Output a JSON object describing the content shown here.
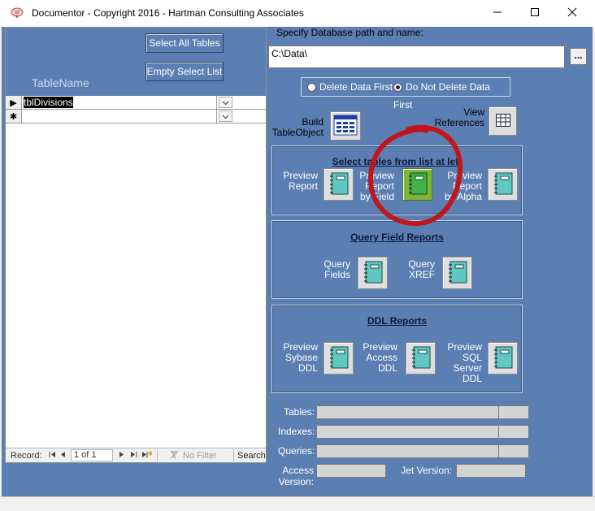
{
  "window": {
    "title": "Documentor - Copyright 2016 - Hartman Consulting Associates",
    "icons": {
      "app": "brain-icon",
      "minimize": "minimize-icon",
      "maximize": "maximize-icon",
      "close": "close-icon"
    }
  },
  "subform": {
    "select_all_label": "Select All Tables",
    "empty_list_label": "Empty Select List",
    "column_header": "TableName",
    "rows": [
      {
        "selector": "▶",
        "value": "tblDivisions"
      },
      {
        "selector": "✱",
        "value": ""
      }
    ],
    "nav": {
      "record_label": "Record:",
      "position": "1 of 1",
      "filter_label": "No Filter",
      "search_label": "Search"
    }
  },
  "db": {
    "path_label": "Specify Database path and name:",
    "path_value": "C:\\Data\\",
    "browse_label": "...",
    "radio_delete": "Delete Data First",
    "radio_no_delete": "Do Not Delete Data First",
    "selected_radio": "no_delete"
  },
  "top_actions": {
    "build_label": "Build\nTableObject",
    "view_label": "View\nReferences"
  },
  "panels": {
    "select_tables": {
      "title": "Select tables from list at left",
      "preview_report": "Preview\nReport",
      "preview_by_field": "Preview\nReport\nby Field",
      "preview_by_alpha": "Preview\nReport\nby Alpha"
    },
    "query_field": {
      "title": "Query Field Reports",
      "query_fields": "Query\nFields",
      "query_xref": "Query\nXREF"
    },
    "ddl": {
      "title": "DDL Reports",
      "sybase": "Preview\nSybase\nDDL",
      "access": "Preview\nAccess\nDDL",
      "sqlserver": "Preview\nSQL\nServer\nDDL"
    }
  },
  "progress": {
    "tables_label": "Tables:",
    "indexes_label": "Indexes:",
    "queries_label": "Queries:"
  },
  "versions": {
    "access_label": "Access Version:",
    "access_value": "",
    "jet_label": "Jet Version:",
    "jet_value": ""
  },
  "annotation": {
    "shape": "red-circle",
    "color": "#c0161b"
  },
  "colors": {
    "form_bg": "#5b7fb3",
    "active_button": "#7fb33a"
  }
}
